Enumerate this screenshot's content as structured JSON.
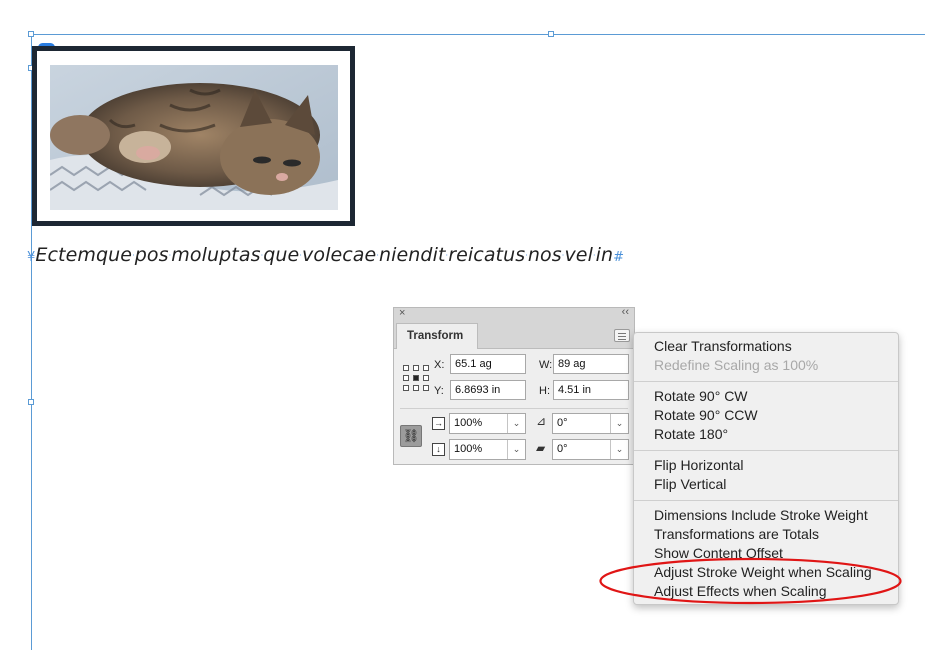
{
  "document": {
    "body_text": [
      "Ectemque",
      "pos",
      "moluptas",
      "que",
      "volecae",
      "niendit",
      "reicatus",
      "nos",
      "vel",
      "in"
    ],
    "end_mark": "#",
    "start_mark": "¥"
  },
  "transform_panel": {
    "tab_label": "Transform",
    "close_glyph": "×",
    "collapse_glyph": "‹‹",
    "x_label": "X:",
    "x_value": "65.1 ag",
    "y_label": "Y:",
    "y_value": "6.8693 in",
    "w_label": "W:",
    "w_value": "89 ag",
    "h_label": "H:",
    "h_value": "4.51 in",
    "scale_x": "100%",
    "scale_y": "100%",
    "rotation": "0°",
    "shear": "0°"
  },
  "flyout_menu": {
    "groups": [
      [
        {
          "label": "Clear Transformations",
          "enabled": true
        },
        {
          "label": "Redefine Scaling as 100%",
          "enabled": false
        }
      ],
      [
        {
          "label": "Rotate 90° CW",
          "enabled": true
        },
        {
          "label": "Rotate 90° CCW",
          "enabled": true
        },
        {
          "label": "Rotate 180°",
          "enabled": true
        }
      ],
      [
        {
          "label": "Flip Horizontal",
          "enabled": true
        },
        {
          "label": "Flip Vertical",
          "enabled": true
        }
      ],
      [
        {
          "label": "Dimensions Include Stroke Weight",
          "enabled": true
        },
        {
          "label": "Transformations are Totals",
          "enabled": true
        },
        {
          "label": "Show Content Offset",
          "enabled": true
        },
        {
          "label": "Adjust Stroke Weight when Scaling",
          "enabled": true
        },
        {
          "label": "Adjust Effects when Scaling",
          "enabled": true
        }
      ]
    ]
  },
  "colors": {
    "guide": "#5b9bd5",
    "frame_stroke": "#1d2733",
    "highlight": "#e01515"
  },
  "icons": {
    "link": "link-icon",
    "chain": "chain-link-icon",
    "rotate": "rotate-angle-icon",
    "shear": "shear-angle-icon",
    "scale_x": "scale-x-icon",
    "scale_y": "scale-y-icon",
    "reference_point": "reference-point-icon",
    "panel_menu": "panel-menu-icon"
  }
}
